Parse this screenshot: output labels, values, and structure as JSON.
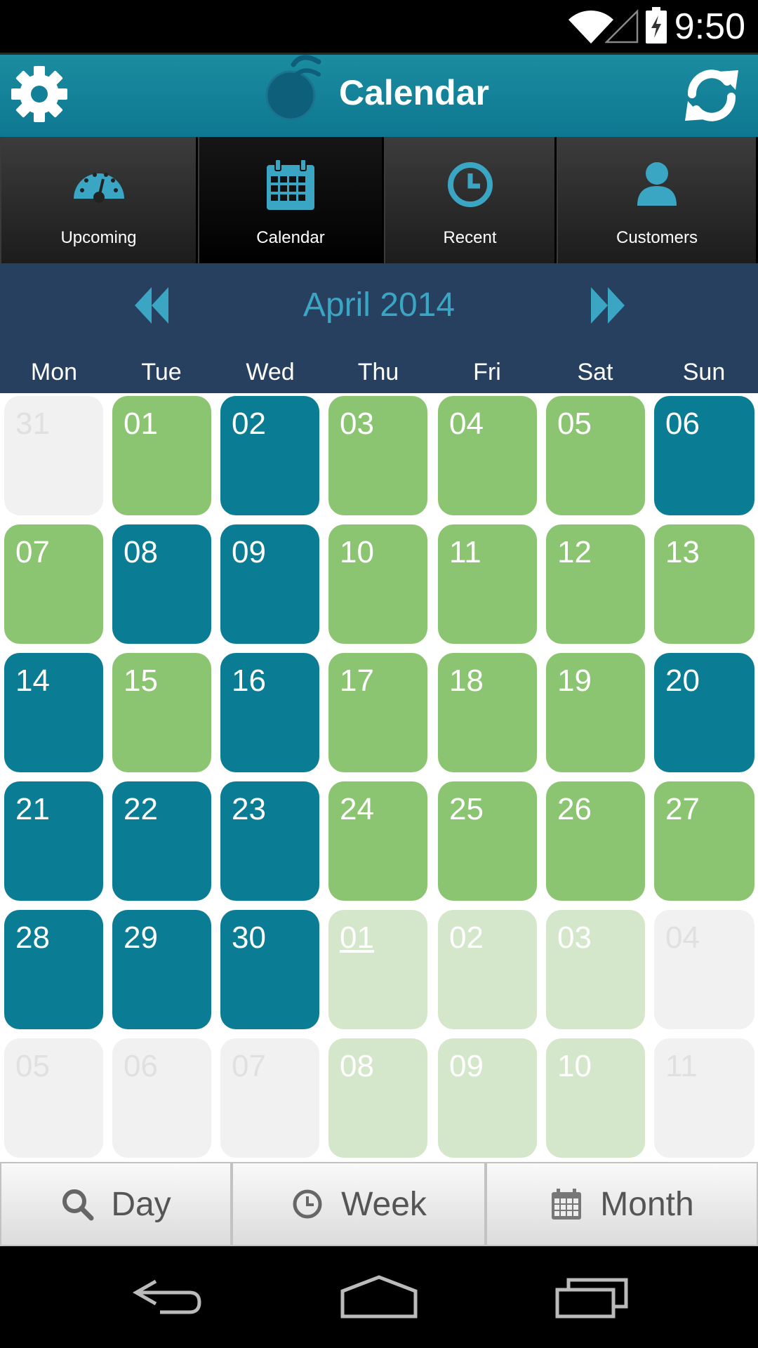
{
  "status_bar": {
    "time": "9:50"
  },
  "action_bar": {
    "title": "Calendar"
  },
  "tabs": [
    {
      "label": "Upcoming",
      "icon": "dashboard-icon",
      "active": false
    },
    {
      "label": "Calendar",
      "icon": "calendar-icon",
      "active": true
    },
    {
      "label": "Recent",
      "icon": "clock-icon",
      "active": false
    },
    {
      "label": "Customers",
      "icon": "person-icon",
      "active": false
    }
  ],
  "calendar": {
    "month_title": "April 2014",
    "weekdays": [
      "Mon",
      "Tue",
      "Wed",
      "Thu",
      "Fri",
      "Sat",
      "Sun"
    ],
    "colors": {
      "green": "#8cc571",
      "teal": "#0a7c93",
      "lightgreen": "#d4e7cb",
      "grey": "#f1f1f1"
    },
    "weeks": [
      [
        {
          "d": "31",
          "s": "grey"
        },
        {
          "d": "01",
          "s": "green"
        },
        {
          "d": "02",
          "s": "teal"
        },
        {
          "d": "03",
          "s": "green"
        },
        {
          "d": "04",
          "s": "green"
        },
        {
          "d": "05",
          "s": "green"
        },
        {
          "d": "06",
          "s": "teal"
        }
      ],
      [
        {
          "d": "07",
          "s": "green"
        },
        {
          "d": "08",
          "s": "teal"
        },
        {
          "d": "09",
          "s": "teal"
        },
        {
          "d": "10",
          "s": "green"
        },
        {
          "d": "11",
          "s": "green"
        },
        {
          "d": "12",
          "s": "green"
        },
        {
          "d": "13",
          "s": "green"
        }
      ],
      [
        {
          "d": "14",
          "s": "teal"
        },
        {
          "d": "15",
          "s": "green"
        },
        {
          "d": "16",
          "s": "teal"
        },
        {
          "d": "17",
          "s": "green"
        },
        {
          "d": "18",
          "s": "green"
        },
        {
          "d": "19",
          "s": "green"
        },
        {
          "d": "20",
          "s": "teal"
        }
      ],
      [
        {
          "d": "21",
          "s": "teal"
        },
        {
          "d": "22",
          "s": "teal"
        },
        {
          "d": "23",
          "s": "teal"
        },
        {
          "d": "24",
          "s": "green"
        },
        {
          "d": "25",
          "s": "green"
        },
        {
          "d": "26",
          "s": "green"
        },
        {
          "d": "27",
          "s": "green"
        }
      ],
      [
        {
          "d": "28",
          "s": "teal"
        },
        {
          "d": "29",
          "s": "teal"
        },
        {
          "d": "30",
          "s": "teal"
        },
        {
          "d": "01",
          "s": "lightgreen",
          "today": true
        },
        {
          "d": "02",
          "s": "lightgreen"
        },
        {
          "d": "03",
          "s": "lightgreen"
        },
        {
          "d": "04",
          "s": "grey"
        }
      ],
      [
        {
          "d": "05",
          "s": "grey"
        },
        {
          "d": "06",
          "s": "grey"
        },
        {
          "d": "07",
          "s": "grey"
        },
        {
          "d": "08",
          "s": "lightgreen"
        },
        {
          "d": "09",
          "s": "lightgreen"
        },
        {
          "d": "10",
          "s": "lightgreen"
        },
        {
          "d": "11",
          "s": "grey"
        }
      ]
    ]
  },
  "view_buttons": [
    {
      "label": "Day",
      "icon": "search-icon"
    },
    {
      "label": "Week",
      "icon": "clock-icon"
    },
    {
      "label": "Month",
      "icon": "calendar-icon"
    }
  ]
}
